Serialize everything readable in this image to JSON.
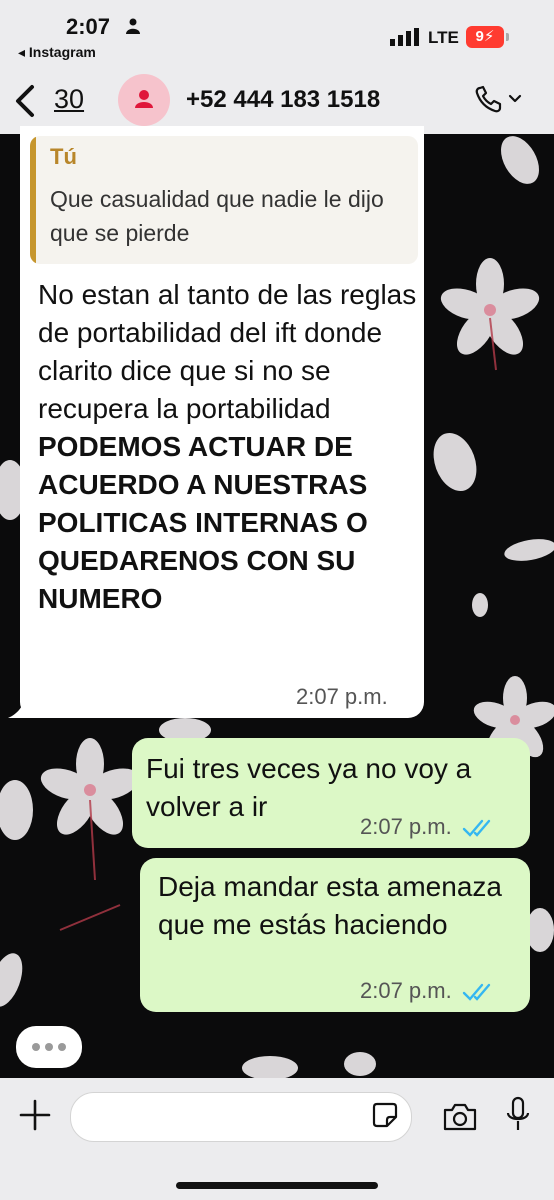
{
  "status_bar": {
    "time": "2:07",
    "back_app": "◂ Instagram",
    "network": "LTE",
    "battery": "9"
  },
  "header": {
    "back_count": "30",
    "contact": "+52 444 183 1518"
  },
  "messages": [
    {
      "direction": "incoming",
      "quote": {
        "sender": "Tú",
        "text": "Que casualidad que nadie le dijo que se pierde"
      },
      "text_plain": "No estan al tanto de las reglas de portabilidad del ift donde clarito dice que si no se recupera la portabilidad",
      "text_bold": "PODEMOS ACTUAR DE ACUERDO A NUESTRAS POLITICAS INTERNAS O QUEDARENOS CON SU NUMERO",
      "time": "2:07 p.m."
    },
    {
      "direction": "outgoing",
      "text": "Fui tres veces ya no voy a volver a ir",
      "time": "2:07 p.m.",
      "status": "read"
    },
    {
      "direction": "outgoing",
      "text": "Deja mandar esta amenaza que me estás haciendo",
      "time": "2:07 p.m.",
      "status": "read"
    }
  ],
  "composer": {
    "placeholder": ""
  },
  "colors": {
    "incoming_bubble": "#ffffff",
    "outgoing_bubble": "#dcf8c6",
    "read_ticks": "#34b7f1",
    "quote_accent": "#c6962e",
    "avatar_bg": "#f6c3cc",
    "avatar_icon": "#e0173b",
    "battery": "#ff3b30"
  }
}
